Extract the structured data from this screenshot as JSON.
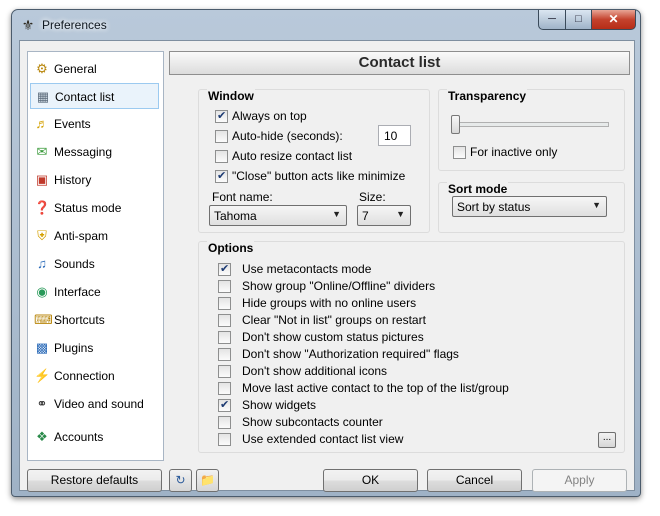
{
  "window": {
    "title": "Preferences"
  },
  "sidebar": {
    "selected": "Contact list",
    "items": [
      {
        "label": "General",
        "icon": "gear-icon"
      },
      {
        "label": "Contact list",
        "icon": "contacts-icon"
      },
      {
        "label": "Events",
        "icon": "bell-icon"
      },
      {
        "label": "Messaging",
        "icon": "chat-icon"
      },
      {
        "label": "History",
        "icon": "calendar-icon"
      },
      {
        "label": "Status mode",
        "icon": "question-icon"
      },
      {
        "label": "Anti-spam",
        "icon": "shield-icon"
      },
      {
        "label": "Sounds",
        "icon": "music-note-icon"
      },
      {
        "label": "Interface",
        "icon": "interface-icon"
      },
      {
        "label": "Shortcuts",
        "icon": "keyboard-icon"
      },
      {
        "label": "Plugins",
        "icon": "puzzle-icon"
      },
      {
        "label": "Connection",
        "icon": "plug-icon"
      },
      {
        "label": "Video and sound",
        "icon": "headphones-icon"
      },
      {
        "label": "Accounts",
        "icon": "accounts-icon"
      }
    ]
  },
  "header": {
    "title": "Contact list"
  },
  "window_group": {
    "title": "Window",
    "options": [
      {
        "label": "Always on top",
        "checked": true
      },
      {
        "label": "Auto-hide (seconds):",
        "checked": false
      },
      {
        "label": "Auto resize contact list",
        "checked": false
      },
      {
        "label": "\"Close\" button acts like minimize",
        "checked": true
      }
    ],
    "autohide_seconds": "10",
    "font_name_label": "Font name:",
    "font_name_value": "Tahoma",
    "size_label": "Size:",
    "size_value": "7"
  },
  "transparency_group": {
    "title": "Transparency",
    "slider_level": 0,
    "inactive_only": {
      "label": "For inactive only",
      "checked": false
    }
  },
  "sort_group": {
    "title": "Sort mode",
    "value": "Sort by status"
  },
  "options_group": {
    "title": "Options",
    "options": [
      {
        "label": "Use metacontacts mode",
        "checked": true
      },
      {
        "label": "Show group \"Online/Offline\" dividers",
        "checked": false
      },
      {
        "label": "Hide groups with no online users",
        "checked": false
      },
      {
        "label": "Clear \"Not in list\" groups on restart",
        "checked": false
      },
      {
        "label": "Don't show custom status pictures",
        "checked": false
      },
      {
        "label": "Don't show \"Authorization required\" flags",
        "checked": false
      },
      {
        "label": "Don't show additional icons",
        "checked": false
      },
      {
        "label": "Move last active contact to the top of the list/group",
        "checked": false
      },
      {
        "label": "Show widgets",
        "checked": true
      },
      {
        "label": "Show subcontacts counter",
        "checked": false
      },
      {
        "label": "Use extended contact list view",
        "checked": false
      }
    ],
    "more_label": "..."
  },
  "footer": {
    "restore_label": "Restore defaults",
    "ok_label": "OK",
    "cancel_label": "Cancel",
    "apply_label": "Apply"
  }
}
